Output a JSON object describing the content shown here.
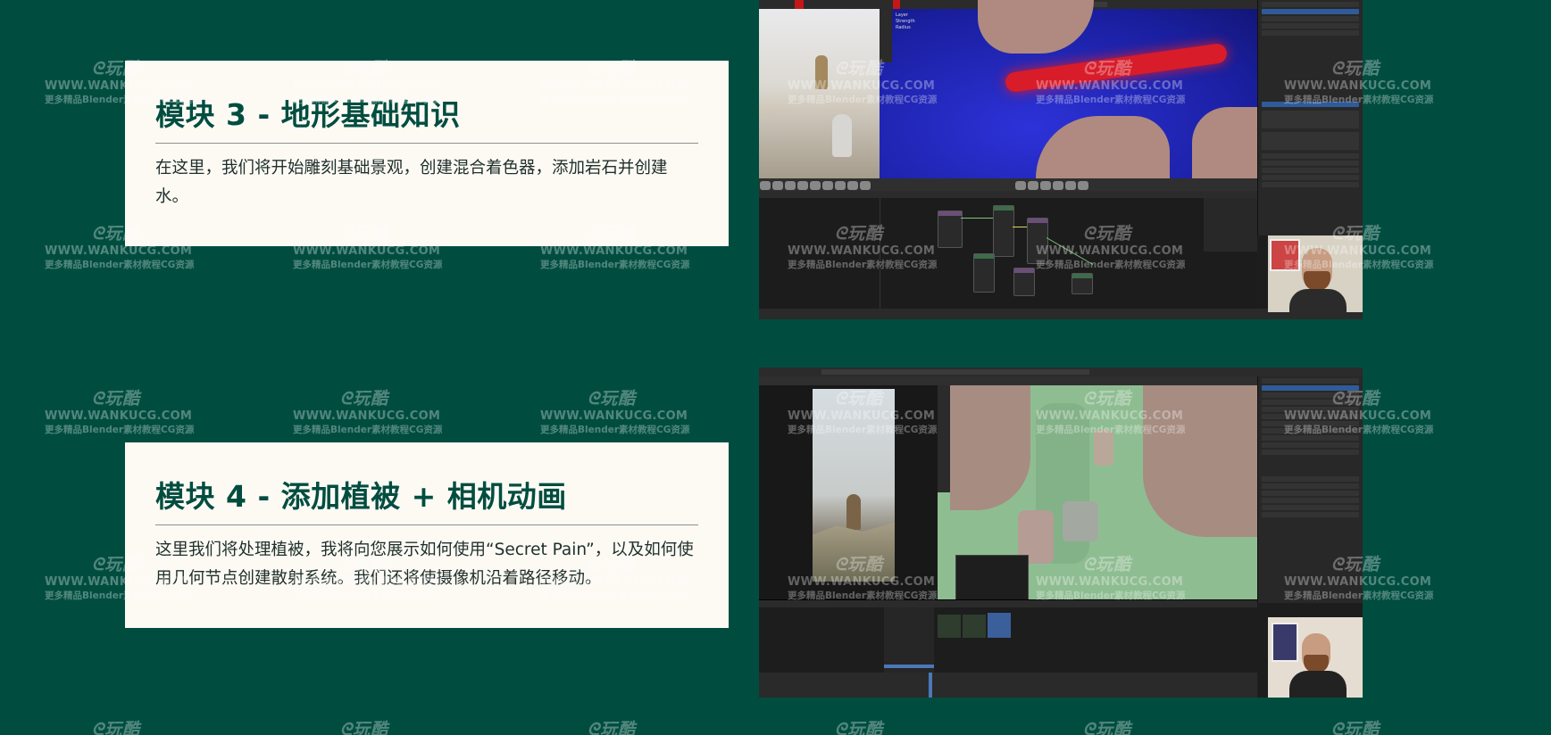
{
  "modules": [
    {
      "title": "模块 3 - 地形基础知识",
      "description": "在这里，我们将开始雕刻基础景观，创建混合着色器，添加岩石并创建水。"
    },
    {
      "title": "模块 4 - 添加植被 + 相机动画",
      "description": "这里我们将处理植被，我将向您展示如何使用“Secret Pain”，以及如何使用几何节点创建散射系统。我们还将使摄像机沿着路径移动。"
    }
  ],
  "watermark": {
    "logo": "玩酷",
    "url": "WWW.WANKUCG.COM",
    "tagline": "更多精品Blender素材教程CG资源"
  },
  "colors": {
    "background": "#004d40",
    "card": "#fdfaf4",
    "heading": "#004d40"
  }
}
